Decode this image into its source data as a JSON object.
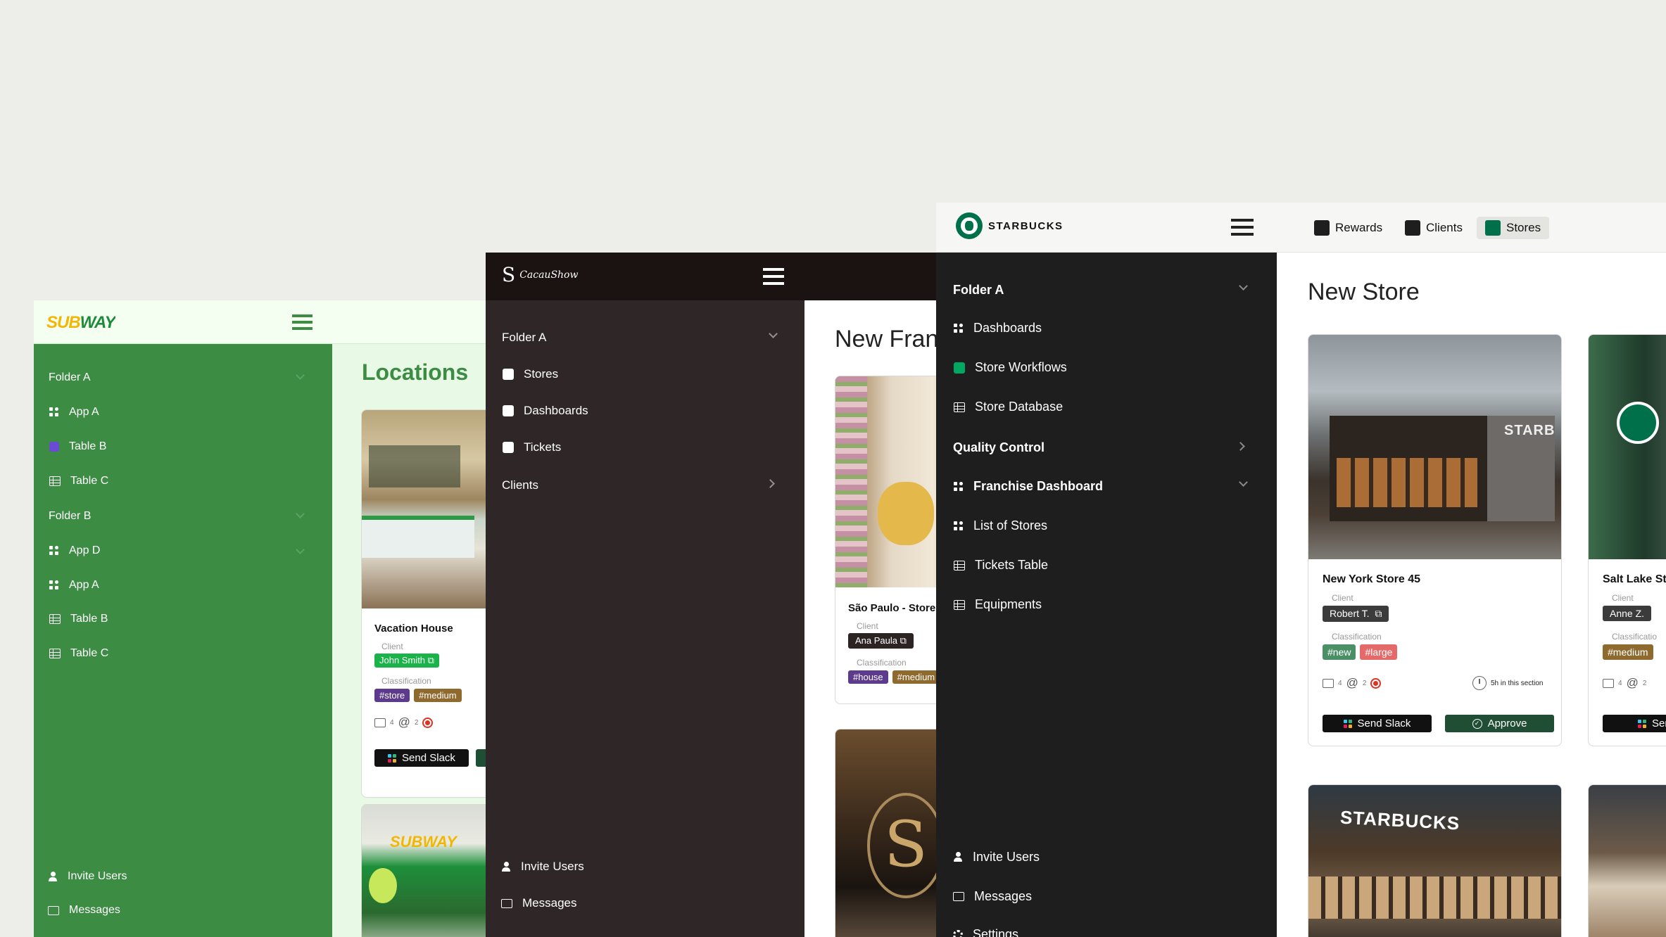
{
  "subway": {
    "logo": "SUBWAY",
    "page_title": "Locations",
    "sidebar": {
      "folder_a": "Folder A",
      "folder_a_items": [
        {
          "label": "App A",
          "icon": "app-icon"
        },
        {
          "label": "Table B",
          "icon": "purple-square-icon"
        },
        {
          "label": "Table C",
          "icon": "table-icon"
        }
      ],
      "folder_b": "Folder B",
      "folder_b_items": [
        {
          "label": "App D",
          "icon": "app-icon"
        },
        {
          "label": "App A",
          "icon": "app-icon"
        },
        {
          "label": "Table B",
          "icon": "table-icon"
        },
        {
          "label": "Table C",
          "icon": "table-icon"
        }
      ],
      "invite": "Invite Users",
      "messages": "Messages"
    },
    "card": {
      "title": "Vacation House",
      "client_label": "Client",
      "client": "John Smith",
      "classification_label": "Classification",
      "tags": [
        "#store",
        "#medium"
      ],
      "comments": "4",
      "mentions": "2",
      "send_slack": "Send Slack"
    }
  },
  "cacaushow": {
    "logo": "CacauShow",
    "page_title": "New Fran",
    "sidebar": {
      "folder_a": "Folder A",
      "items": [
        "Stores",
        "Dashboards",
        "Tickets"
      ],
      "clients": "Clients",
      "invite": "Invite Users",
      "messages": "Messages"
    },
    "card": {
      "title": "São Paulo - Store",
      "client_label": "Client",
      "client": "Ana Paula",
      "classification_label": "Classification",
      "tags": [
        "#house",
        "#medium"
      ]
    }
  },
  "starbucks": {
    "logo": "STARBUCKS",
    "tabs": [
      {
        "label": "Rewards"
      },
      {
        "label": "Clients"
      },
      {
        "label": "Stores",
        "active": true
      }
    ],
    "page_title": "New Store",
    "sidebar": {
      "folder_a": "Folder A",
      "folder_a_items": [
        {
          "label": "Dashboards",
          "icon": "app-icon"
        },
        {
          "label": "Store Workflows",
          "icon": "green-square-icon"
        },
        {
          "label": "Store Database",
          "icon": "table-icon"
        }
      ],
      "quality": "Quality Control",
      "franchise": "Franchise Dashboard",
      "franchise_items": [
        {
          "label": "List of Stores",
          "icon": "app-icon"
        },
        {
          "label": "Tickets Table",
          "icon": "table-icon"
        },
        {
          "label": "Equipments",
          "icon": "table-icon"
        }
      ],
      "invite": "Invite Users",
      "messages": "Messages",
      "settings": "Settings"
    },
    "card1": {
      "title": "New York Store 45",
      "client_label": "Client",
      "client": "Robert T.",
      "classification_label": "Classification",
      "tags": [
        "#new",
        "#large"
      ],
      "comments": "4",
      "mentions": "2",
      "time": "5h in this section",
      "send_slack": "Send Slack",
      "approve": "Approve",
      "sign": "STARB"
    },
    "card2": {
      "title": "Salt Lake St",
      "client_label": "Client",
      "client": "Anne Z.",
      "classification_label": "Classificatio",
      "tags": [
        "#medium"
      ],
      "comments": "4",
      "mentions": "2",
      "send_slack": "Send"
    },
    "card3": {
      "sign": "STARBUCKS"
    }
  },
  "colors": {
    "subway_green": "#3c8c44",
    "subway_bg": "#e8f9e6",
    "cacau_dark": "#2f2727",
    "starbucks_dark": "#1e1e1e",
    "starbucks_green": "#00704a"
  }
}
